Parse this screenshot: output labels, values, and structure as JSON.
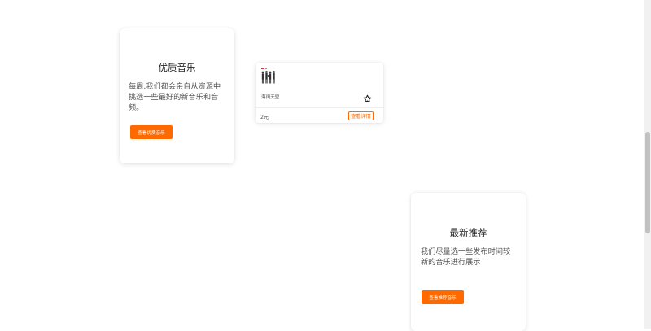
{
  "featured_cards": [
    {
      "title": "优质音乐",
      "description": "每周,我们都会亲自从资源中挑选一些最好的新音乐和音频。",
      "button_label": "查看优质音乐"
    },
    {
      "title": "最新推荐",
      "description": "我们尽量选一些发布时间较新的音乐进行展示",
      "button_label": "查看推荐音乐"
    }
  ],
  "product": {
    "name": "海阔天空",
    "price": "2元",
    "detail_button_label": "查看详情",
    "favorite_icon": "star-outline-icon"
  },
  "colors": {
    "accent": "#ff6a00",
    "background": "#ffffff"
  }
}
